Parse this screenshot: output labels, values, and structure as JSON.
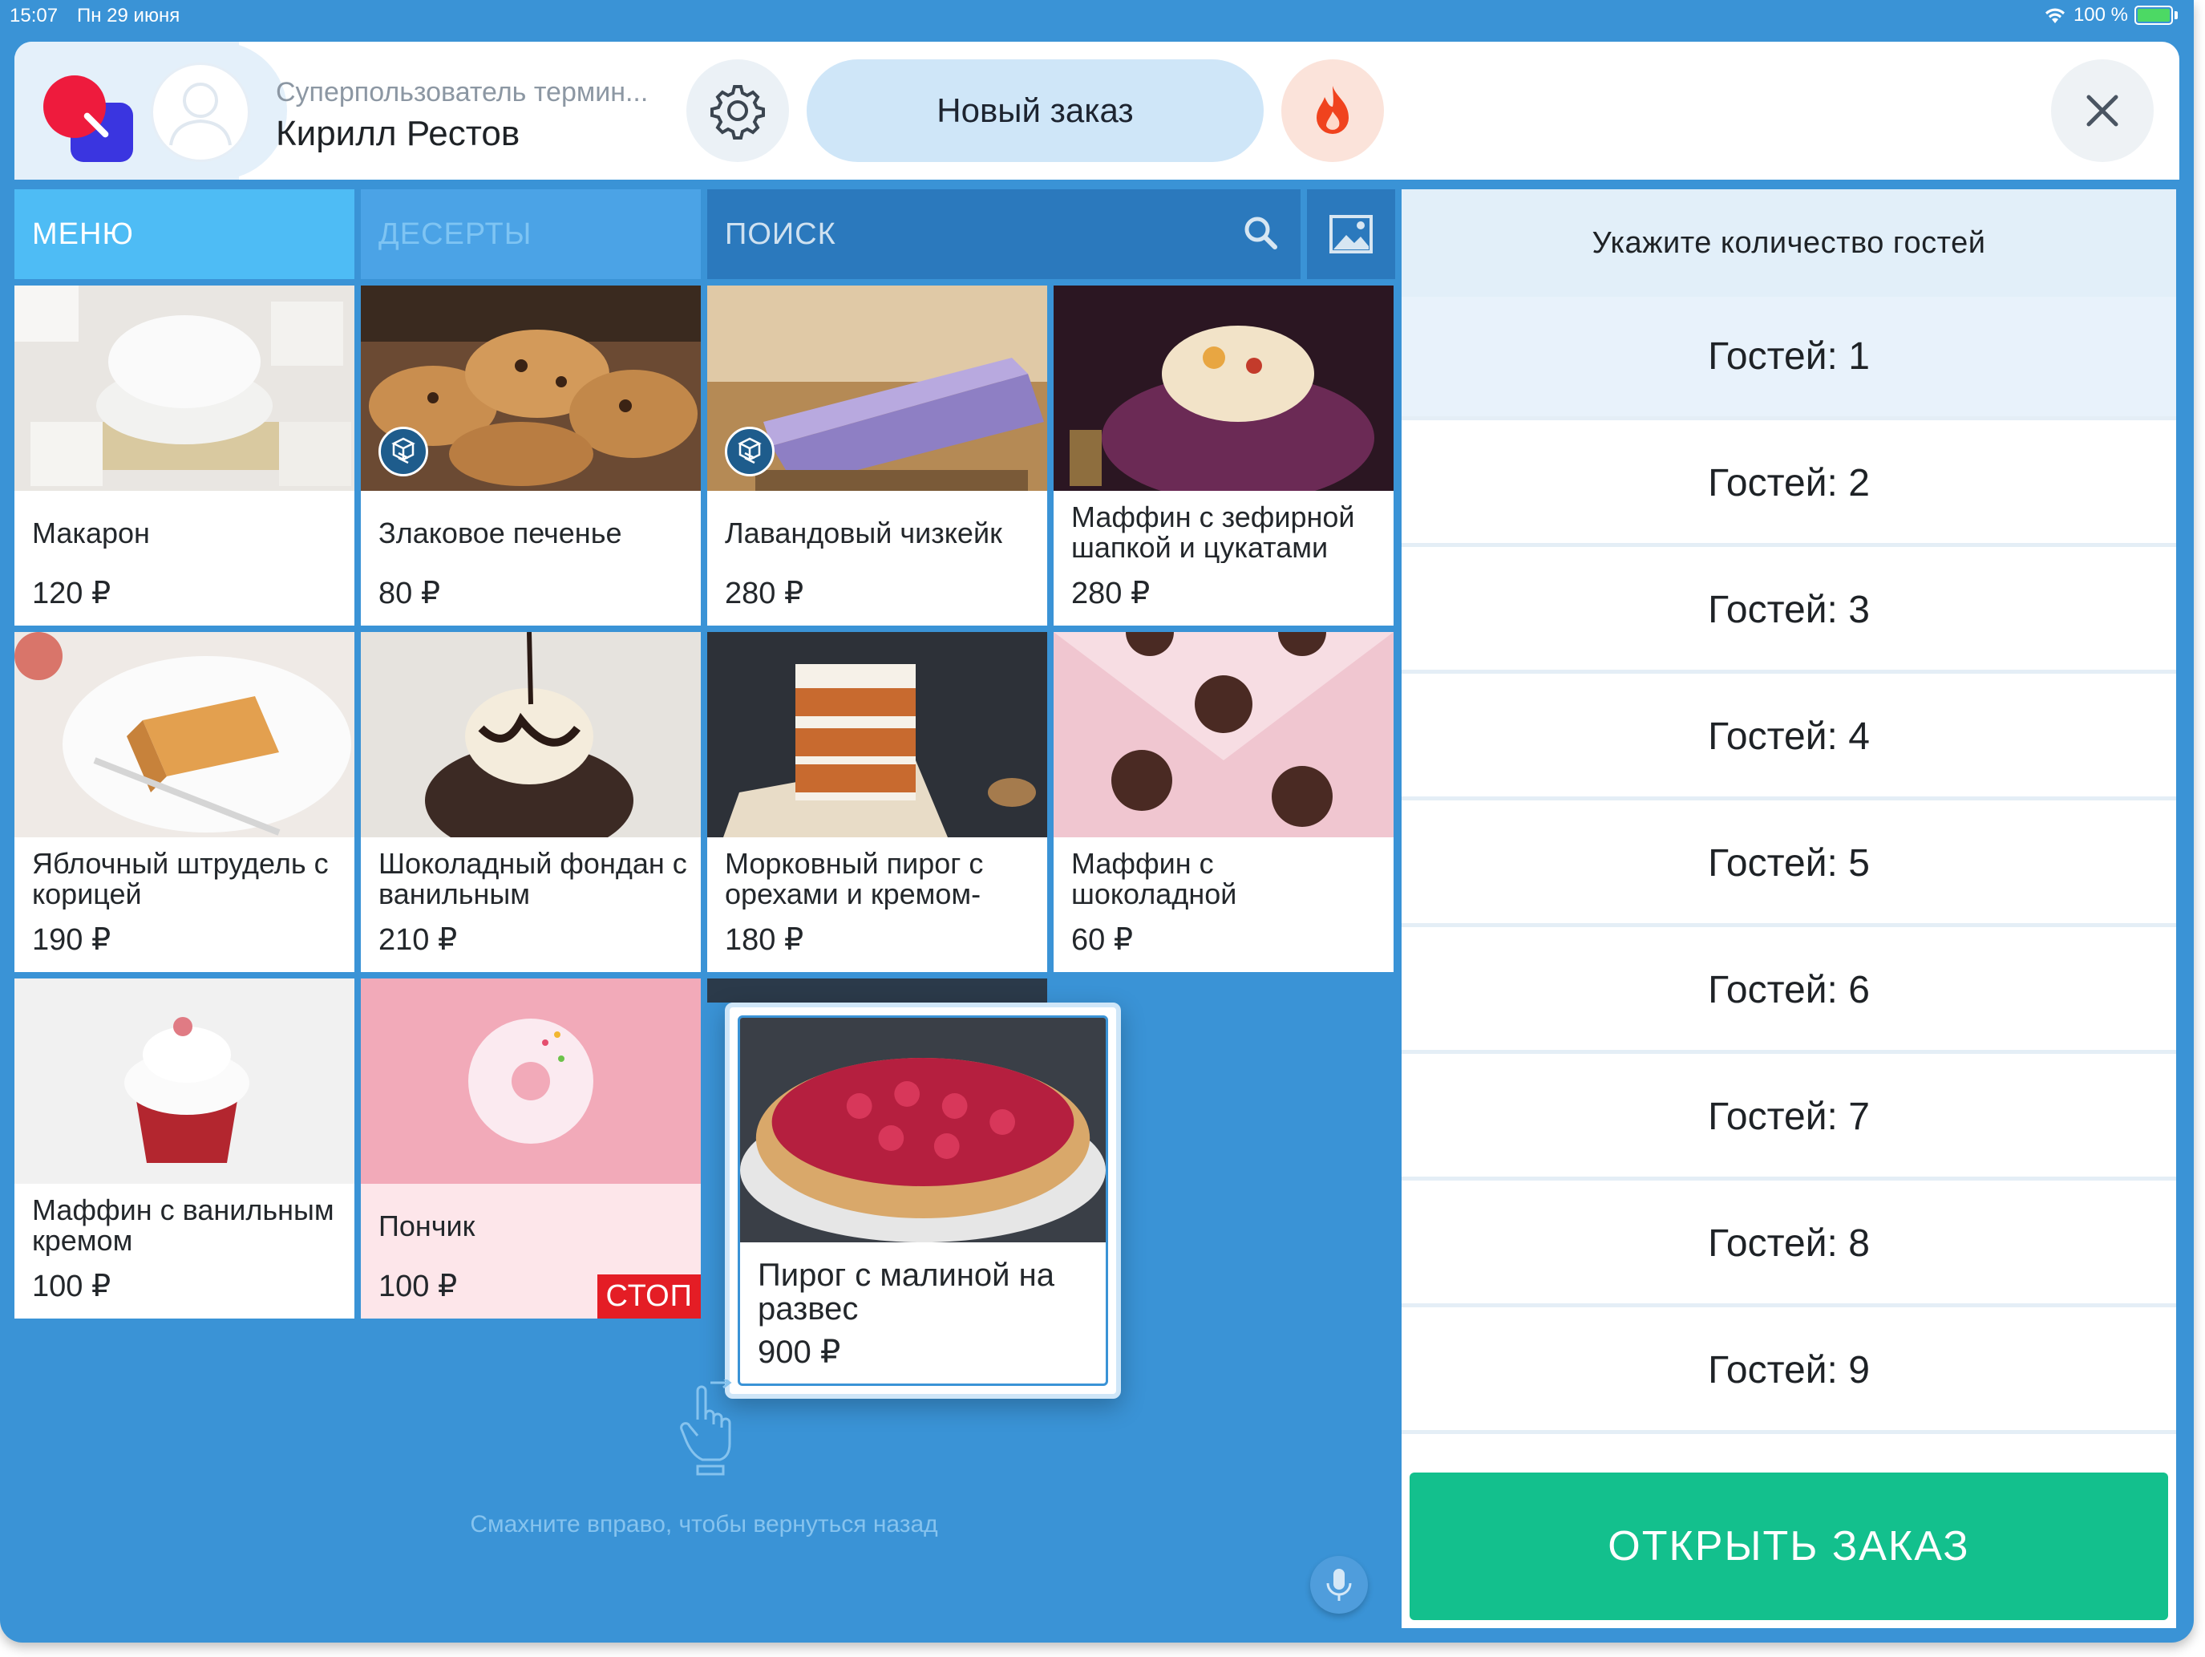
{
  "status_bar": {
    "time": "15:07",
    "date": "Пн 29 июня",
    "battery": "100 %"
  },
  "header": {
    "user_role": "Суперпользователь термин...",
    "user_name": "Кирилл Рестов",
    "new_order_label": "Новый заказ"
  },
  "tabs": {
    "menu": "МЕНЮ",
    "desserts": "ДЕСЕРТЫ",
    "search": "ПОИСК"
  },
  "products": [
    {
      "name": "Макарон",
      "price": "120 ₽"
    },
    {
      "name": "Злаковое печенье",
      "price": "80 ₽"
    },
    {
      "name": "Лавандовый чизкейк",
      "price": "280 ₽"
    },
    {
      "name": "Маффин с зефирной шапкой и цукатами",
      "price": "280 ₽"
    },
    {
      "name": "Яблочный штрудель с корицей",
      "price": "190 ₽"
    },
    {
      "name": "Шоколадный фондан с ванильным",
      "price": "210 ₽"
    },
    {
      "name": "Морковный пирог с орехами и кремом-",
      "price": "180 ₽"
    },
    {
      "name": "Маффин с шоколадной",
      "price": "60 ₽"
    },
    {
      "name": "Маффин с ванильным кремом",
      "price": "100 ₽"
    },
    {
      "name": "Пончик",
      "price": "100 ₽",
      "badge": "СТОП"
    }
  ],
  "dragged_item": {
    "name": "Пирог с малиной на развес",
    "price": "900 ₽"
  },
  "swipe_hint": "Смахните вправо, чтобы вернуться назад",
  "guests_panel": {
    "title": "Укажите количество гостей",
    "options": [
      "Гостей: 1",
      "Гостей: 2",
      "Гостей: 3",
      "Гостей: 4",
      "Гостей: 5",
      "Гостей: 6",
      "Гостей: 7",
      "Гостей: 8",
      "Гостей: 9"
    ],
    "selected": "Гостей: 1",
    "open_order_label": "ОТКРЫТЬ ЗАКАЗ"
  },
  "icons": [
    "wifi-icon",
    "battery-icon",
    "logo-icon",
    "avatar-icon",
    "gear-icon",
    "fire-icon",
    "close-icon",
    "search-icon",
    "image-icon",
    "combo-icon",
    "swipe-hand-icon",
    "microphone-icon"
  ],
  "colors": {
    "background": "#3a93d6",
    "accent_green": "#13c08d",
    "stop_red": "#e41d25",
    "tab_active": "#4ebcf5"
  }
}
